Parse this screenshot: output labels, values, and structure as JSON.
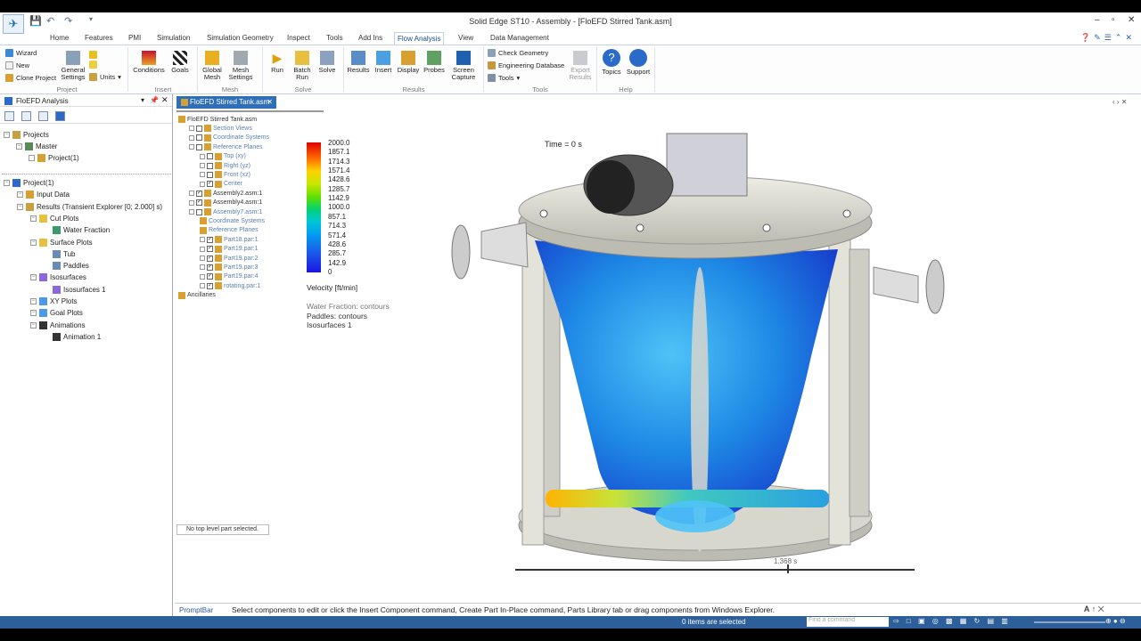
{
  "window": {
    "title": "Solid Edge ST10 - Assembly - [FloEFD Stirred Tank.asm]",
    "controls": [
      "–",
      "▫",
      "✕"
    ]
  },
  "tabs": [
    "Home",
    "Features",
    "PMI",
    "Simulation",
    "Simulation Geometry",
    "Inspect",
    "Tools",
    "Add Ins",
    "Flow Analysis",
    "View",
    "Data Management"
  ],
  "active_tab": "Flow Analysis",
  "ribbon": {
    "project": {
      "wizard": "Wizard",
      "new": "New",
      "clone": "Clone Project",
      "general": "General Settings",
      "units": "Units",
      "group": "Project"
    },
    "insert": {
      "conditions": "Conditions",
      "goals": "Goals",
      "group": "Insert"
    },
    "mesh": {
      "global": "Global Mesh",
      "settings": "Mesh Settings",
      "group": "Mesh"
    },
    "solve": {
      "run": "Run",
      "batch": "Batch Run",
      "solve": "Solve",
      "group": "Solve"
    },
    "results": {
      "results": "Results",
      "insert": "Insert",
      "display": "Display",
      "probes": "Probes",
      "capture": "Screen Capture",
      "group": "Results"
    },
    "tools": {
      "check": "Check Geometry",
      "engdb": "Engineering Database",
      "tools": "Tools",
      "export": "Export Results",
      "group": "Tools"
    },
    "help": {
      "topics": "Topics",
      "support": "Support",
      "group": "Help"
    }
  },
  "left_panel": {
    "title": "FloEFD Analysis",
    "projects_tree": [
      {
        "label": "Projects",
        "level": 0
      },
      {
        "label": "Master",
        "level": 1
      },
      {
        "label": "Project(1)",
        "level": 2
      }
    ],
    "results_tree": [
      {
        "label": "Project(1)",
        "level": 0
      },
      {
        "label": "Input Data",
        "level": 1
      },
      {
        "label": "Results (Transient Explorer [0; 2.000] s)",
        "level": 1
      },
      {
        "label": "Cut Plots",
        "level": 2
      },
      {
        "label": "Water Fraction",
        "level": 3
      },
      {
        "label": "Surface Plots",
        "level": 2
      },
      {
        "label": "Tub",
        "level": 3
      },
      {
        "label": "Paddles",
        "level": 3
      },
      {
        "label": "Isosurfaces",
        "level": 2
      },
      {
        "label": "Isosurfaces 1",
        "level": 3
      },
      {
        "label": "XY Plots",
        "level": 2
      },
      {
        "label": "Goal Plots",
        "level": 2
      },
      {
        "label": "Animations",
        "level": 2
      },
      {
        "label": "Animation 1",
        "level": 3
      }
    ]
  },
  "document_tab": "FloEFD Stirred Tank.asm",
  "pathfinder": [
    {
      "label": "FloEFD Stirred Tank.asm",
      "indent": 0,
      "check": null
    },
    {
      "label": "Section Views",
      "indent": 1,
      "check": false,
      "dim": true
    },
    {
      "label": "Coordinate Systems",
      "indent": 1,
      "check": false,
      "dim": true
    },
    {
      "label": "Reference Planes",
      "indent": 1,
      "check": false,
      "dim": true
    },
    {
      "label": "Top (xy)",
      "indent": 2,
      "check": false,
      "dim": true
    },
    {
      "label": "Right (yz)",
      "indent": 2,
      "check": false,
      "dim": true
    },
    {
      "label": "Front (xz)",
      "indent": 2,
      "check": false,
      "dim": true
    },
    {
      "label": "Center",
      "indent": 2,
      "check": true,
      "dim": true
    },
    {
      "label": "Assembly2.asm:1",
      "indent": 1,
      "check": true
    },
    {
      "label": "Assembly4.asm:1",
      "indent": 1,
      "check": true
    },
    {
      "label": "Assembly7.asm:1",
      "indent": 1,
      "check": false,
      "dim": true
    },
    {
      "label": "Coordinate Systems",
      "indent": 2,
      "check": null,
      "dim": true
    },
    {
      "label": "Reference Planes",
      "indent": 2,
      "check": null,
      "dim": true
    },
    {
      "label": "Part18.par:1",
      "indent": 2,
      "check": true,
      "dim": true
    },
    {
      "label": "Part19.par:1",
      "indent": 2,
      "check": true,
      "dim": true
    },
    {
      "label": "Part19.par:2",
      "indent": 2,
      "check": true,
      "dim": true
    },
    {
      "label": "Part19.par:3",
      "indent": 2,
      "check": true,
      "dim": true
    },
    {
      "label": "Part19.par:4",
      "indent": 2,
      "check": true,
      "dim": true
    },
    {
      "label": "rotating.par:1",
      "indent": 2,
      "check": true,
      "dim": true
    },
    {
      "label": "Ancillaries",
      "indent": 0,
      "check": null
    }
  ],
  "no_part_msg": "No top level part selected.",
  "legend": {
    "values": [
      "2000.0",
      "1857.1",
      "1714.3",
      "1571.4",
      "1428.6",
      "1285.7",
      "1142.9",
      "1000.0",
      "857.1",
      "714.3",
      "571.4",
      "428.6",
      "285.7",
      "142.9",
      "0"
    ],
    "title": "Velocity [ft/min]",
    "info": [
      "Water Fraction: contours",
      "Paddles: contours",
      "Isosurfaces 1"
    ]
  },
  "time_label": "Time = 0 s",
  "slider_label": "1.368 s",
  "prompt": {
    "label": "PromptBar",
    "text": "Select components to edit or click the Insert Component command, Create Part In-Place command, Parts Library tab or drag components from Windows Explorer."
  },
  "status": {
    "selected": "0 items are selected",
    "find_placeholder": "Find a command"
  }
}
